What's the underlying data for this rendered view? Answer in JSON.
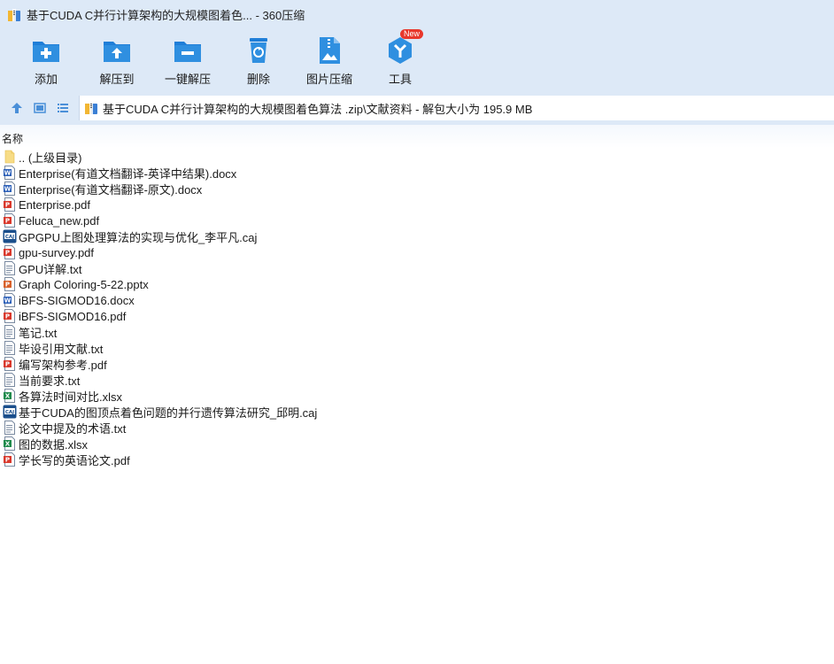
{
  "window": {
    "title": "基于CUDA C并行计算架构的大规模图着色... - 360压缩"
  },
  "toolbar": {
    "items": [
      {
        "label": "添加",
        "icon": "add-folder-icon"
      },
      {
        "label": "解压到",
        "icon": "extract-to-folder-icon"
      },
      {
        "label": "一键解压",
        "icon": "one-click-extract-icon"
      },
      {
        "label": "删除",
        "icon": "recycle-bin-icon"
      },
      {
        "label": "图片压缩",
        "icon": "image-compress-icon"
      },
      {
        "label": "工具",
        "icon": "tools-icon",
        "badge": "New"
      }
    ]
  },
  "address": {
    "path": "基于CUDA C并行计算架构的大规模图着色算法 .zip\\文献资料 - 解包大小为 195.9 MB"
  },
  "list": {
    "column_name": "名称",
    "files": [
      {
        "name": ".. (上级目录)",
        "type": "folder"
      },
      {
        "name": "Enterprise(有道文档翻译-英译中结果).docx",
        "type": "docx"
      },
      {
        "name": "Enterprise(有道文档翻译-原文).docx",
        "type": "docx"
      },
      {
        "name": "Enterprise.pdf",
        "type": "pdf"
      },
      {
        "name": "Feluca_new.pdf",
        "type": "pdf"
      },
      {
        "name": "GPGPU上图处理算法的实现与优化_李平凡.caj",
        "type": "caj"
      },
      {
        "name": "gpu-survey.pdf",
        "type": "pdf"
      },
      {
        "name": "GPU详解.txt",
        "type": "txt"
      },
      {
        "name": "Graph Coloring-5-22.pptx",
        "type": "pptx"
      },
      {
        "name": "iBFS-SIGMOD16.docx",
        "type": "docx"
      },
      {
        "name": "iBFS-SIGMOD16.pdf",
        "type": "pdf"
      },
      {
        "name": "笔记.txt",
        "type": "txt"
      },
      {
        "name": "毕设引用文献.txt",
        "type": "txt"
      },
      {
        "name": "编写架构参考.pdf",
        "type": "pdf"
      },
      {
        "name": "当前要求.txt",
        "type": "txt"
      },
      {
        "name": "各算法时间对比.xlsx",
        "type": "xlsx"
      },
      {
        "name": "基于CUDA的图顶点着色问题的并行遗传算法研究_邱明.caj",
        "type": "caj"
      },
      {
        "name": "论文中提及的术语.txt",
        "type": "txt"
      },
      {
        "name": "图的数据.xlsx",
        "type": "xlsx"
      },
      {
        "name": "学长写的英语论文.pdf",
        "type": "pdf"
      }
    ]
  },
  "colors": {
    "chrome": "#dde9f7",
    "accent": "#2f8fe0",
    "badge": "#e8372c"
  }
}
